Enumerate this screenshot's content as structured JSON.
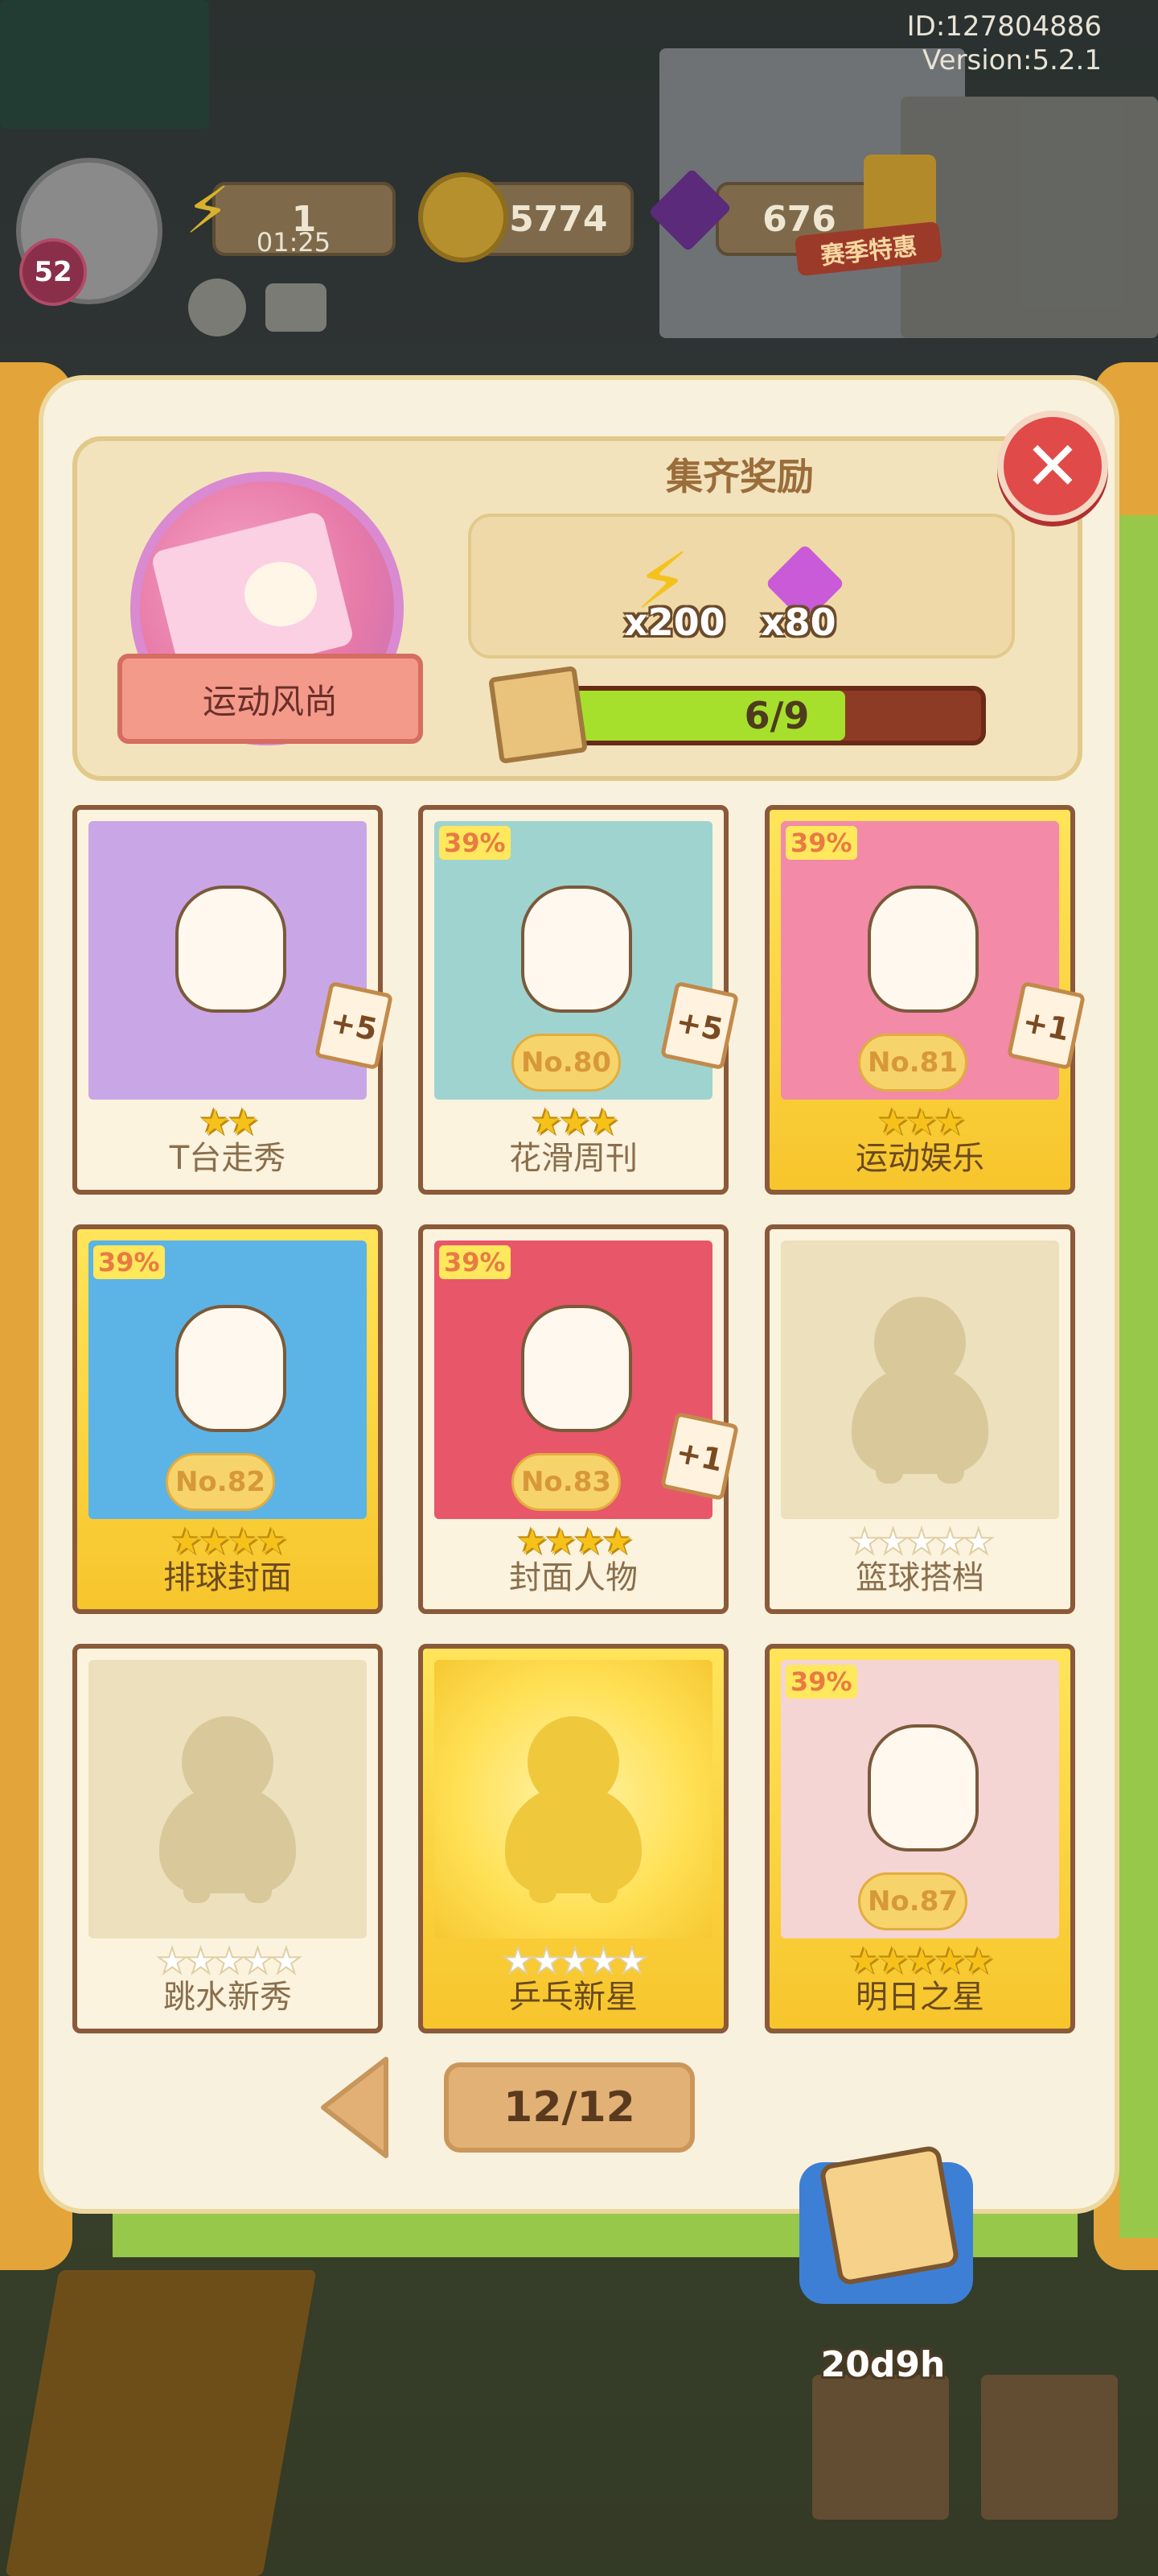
{
  "hud": {
    "player_id": "ID:127804886",
    "version": "Version:5.2.1",
    "level": "52",
    "energy": "1",
    "energy_timer": "01:25",
    "coins": "25774",
    "gems": "676",
    "event_label": "赛季特惠"
  },
  "album": {
    "name": "运动风尚",
    "reward_title": "集齐奖励",
    "rewards": [
      {
        "icon": "energy-bolt-icon",
        "amount": "x200"
      },
      {
        "icon": "purple-gem-icon",
        "amount": "x80"
      }
    ],
    "progress_text": "6/9",
    "progress_fraction": 0.667
  },
  "cards": [
    {
      "name": "T台走秀",
      "stars_total": 2,
      "stars_on": 2,
      "dup": "+5",
      "owned": true,
      "gold": false,
      "number": "",
      "pct": ""
    },
    {
      "name": "花滑周刊",
      "stars_total": 3,
      "stars_on": 3,
      "dup": "+5",
      "owned": true,
      "gold": false,
      "number": "No.80",
      "pct": "39%"
    },
    {
      "name": "运动娱乐",
      "stars_total": 3,
      "stars_on": 3,
      "dup": "+1",
      "owned": true,
      "gold": true,
      "number": "No.81",
      "pct": "39%"
    },
    {
      "name": "排球封面",
      "stars_total": 4,
      "stars_on": 4,
      "dup": "",
      "owned": true,
      "gold": true,
      "number": "No.82",
      "pct": "39%"
    },
    {
      "name": "封面人物",
      "stars_total": 4,
      "stars_on": 4,
      "dup": "+1",
      "owned": true,
      "gold": false,
      "number": "No.83",
      "pct": "39%"
    },
    {
      "name": "篮球搭档",
      "stars_total": 5,
      "stars_on": 0,
      "dup": "",
      "owned": false,
      "gold": false,
      "number": "",
      "pct": ""
    },
    {
      "name": "跳水新秀",
      "stars_total": 5,
      "stars_on": 0,
      "dup": "",
      "owned": false,
      "gold": false,
      "number": "",
      "pct": ""
    },
    {
      "name": "乒乓新星",
      "stars_total": 5,
      "stars_on": 0,
      "dup": "",
      "owned": false,
      "gold": true,
      "number": "",
      "pct": ""
    },
    {
      "name": "明日之星",
      "stars_total": 5,
      "stars_on": 5,
      "dup": "",
      "owned": true,
      "gold": true,
      "number": "No.87",
      "pct": "39%"
    }
  ],
  "pager": {
    "page": "12/12"
  },
  "bottom": {
    "timer": "20d9h"
  },
  "colors": {
    "panel": "#f8f1dd",
    "frame_orange": "#e3a53a",
    "progress_fill": "#a6e02c",
    "progress_track": "#8e3b25",
    "close_red": "#e04a48",
    "card_gold": "#f7c52c"
  }
}
